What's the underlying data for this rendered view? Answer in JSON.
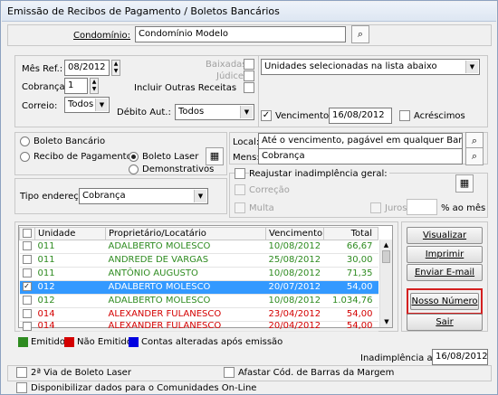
{
  "window": {
    "title": "Emissão de Recibos de Pagamento / Boletos Bancários"
  },
  "condominio": {
    "label": "Condomínio:",
    "value": "Condomínio Modelo"
  },
  "mes_ref": {
    "label": "Mês Ref.:",
    "value": "08/2012"
  },
  "cobranca": {
    "label": "Cobrança:",
    "value": "1"
  },
  "correio": {
    "label": "Correio:",
    "value": "Todos"
  },
  "baixadas": {
    "label": "Baixadas"
  },
  "judice": {
    "label": "Júdice"
  },
  "outras_receitas": {
    "label": "Incluir Outras Receitas"
  },
  "debito_aut": {
    "label": "Débito Aut.:",
    "value": "Todos"
  },
  "unidades_select": {
    "value": "Unidades selecionadas na lista abaixo"
  },
  "vencimento": {
    "label": "Vencimento",
    "value": "16/08/2012"
  },
  "acrescimos": {
    "label": "Acréscimos"
  },
  "tipo_doc": {
    "boleto_bancario": "Boleto Bancário",
    "recibo_pagamento": "Recibo de Pagamento",
    "boleto_laser": "Boleto Laser",
    "demonstrativos": "Demonstrativos"
  },
  "local": {
    "label": "Local:",
    "value": "Até o vencimento, pagável em qualquer Banco."
  },
  "mens": {
    "label": "Mens:",
    "value": "Cobrança"
  },
  "tipo_endereco": {
    "label": "Tipo endereço:",
    "value": "Cobrança"
  },
  "reajustar": {
    "label": "Reajustar inadimplência geral:",
    "correcao": "Correção",
    "multa": "Multa",
    "juros": "Juros",
    "ao_mes": "% ao mês"
  },
  "table": {
    "headers": [
      "Unidade",
      "Proprietário/Locatário",
      "Vencimento",
      "Total"
    ],
    "rows": [
      {
        "unidade": "011",
        "nome": "ADALBERTO MOLESCO",
        "venc": "10/08/2012",
        "total": "66,67",
        "checked": "",
        "state": "green"
      },
      {
        "unidade": "011",
        "nome": "ANDREDE DE VARGAS",
        "venc": "25/08/2012",
        "total": "30,00",
        "checked": "",
        "state": "green"
      },
      {
        "unidade": "011",
        "nome": "ANTÔNIO AUGUSTO",
        "venc": "10/08/2012",
        "total": "71,35",
        "checked": "",
        "state": "green"
      },
      {
        "unidade": "012",
        "nome": "ADALBERTO MOLESCO",
        "venc": "20/07/2012",
        "total": "54,00",
        "checked": "✓",
        "state": "selrow"
      },
      {
        "unidade": "012",
        "nome": "ADALBERTO MOLESCO",
        "venc": "10/08/2012",
        "total": "1.034,76",
        "checked": "",
        "state": "green"
      },
      {
        "unidade": "014",
        "nome": "ALEXANDER FULANESCO",
        "venc": "23/04/2012",
        "total": "54,00",
        "checked": "",
        "state": "red"
      },
      {
        "unidade": "014",
        "nome": "ALEXANDER FULANESCO",
        "venc": "20/04/2012",
        "total": "54,00",
        "checked": "",
        "state": "red"
      }
    ]
  },
  "buttons": {
    "visualizar": "Visualizar",
    "imprimir": "Imprimir",
    "enviar_email": "Enviar E-mail",
    "nosso_numero": "Nosso Número",
    "sair": "Sair"
  },
  "legend": {
    "emitido": "Emitido",
    "nao_emitido": "Não Emitido",
    "alteradas": "Contas alteradas após emissão"
  },
  "colors": {
    "emitido": "#2e8b20",
    "nao_emitido": "#d40000",
    "alteradas": "#0000e0",
    "highlight": "#d42020"
  },
  "inadimplencia": {
    "label": "Inadimplência até:",
    "value": "16/08/2012"
  },
  "segunda_via": {
    "label": "2ª Via de Boleto Laser"
  },
  "afastar": {
    "label": "Afastar Cód. de Barras da Margem"
  },
  "disponibilizar": {
    "label": "Disponibilizar dados para o Comunidades On-Line"
  }
}
